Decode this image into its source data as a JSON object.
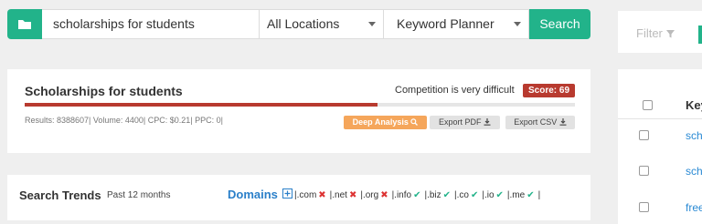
{
  "search": {
    "query": "scholarships for students",
    "location": "All Locations",
    "source": "Keyword Planner",
    "button": "Search"
  },
  "sidebar": {
    "filter_label": "Filter",
    "column_header": "Key",
    "rows": [
      "scho",
      "scho",
      "free"
    ]
  },
  "summary": {
    "title": "Scholarships for students",
    "competition": "Competition is very difficult",
    "score": "Score: 69",
    "score_value": 69,
    "stats": "Results: 8388607| Volume: 4400| CPC: $0.21| PPC: 0|",
    "deep_analysis": "Deep Analysis",
    "export_pdf": "Export PDF",
    "export_csv": "Export CSV",
    "colors": {
      "accent": "#22b38a",
      "score": "#b83a2f",
      "deep": "#f5a65b",
      "link": "#2a7fc9"
    }
  },
  "trends": {
    "title": "Search Trends",
    "subtitle": "Past 12 months",
    "domains_label": "Domains",
    "tlds": [
      {
        "name": "|.com",
        "available": false
      },
      {
        "name": "|.net",
        "available": false
      },
      {
        "name": "|.org",
        "available": false
      },
      {
        "name": "|.info",
        "available": true
      },
      {
        "name": "|.biz",
        "available": true
      },
      {
        "name": "|.co",
        "available": true
      },
      {
        "name": "|.io",
        "available": true
      },
      {
        "name": "|.me",
        "available": true
      }
    ],
    "end_bar": "|"
  }
}
